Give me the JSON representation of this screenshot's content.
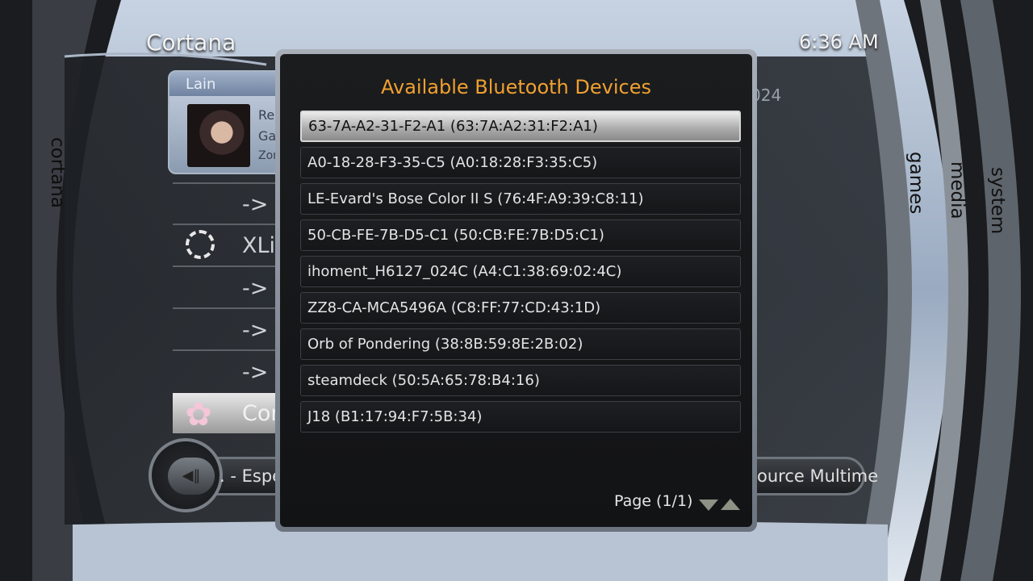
{
  "header": {
    "title": "Cortana",
    "clock": "6:36 AM"
  },
  "tabs": {
    "left": "cortana",
    "right": [
      "games",
      "media",
      "system"
    ]
  },
  "profile": {
    "name": "Lain",
    "line1": "Rep",
    "line2": "Gar",
    "line3": "Zon"
  },
  "background_list": {
    "rows": [
      "-> Ex",
      "XLin",
      "-> S",
      "-> S",
      "-> Ex",
      "Cort"
    ],
    "partial_right_1": "024"
  },
  "music": {
    "ticker": ". - Esperanto: The Language That Wanted to Unite the World – Free Source Multime",
    "ticker_visible": ". - Espe",
    "ticker_tail": "ource Multime"
  },
  "dialog": {
    "title": "Available Bluetooth Devices",
    "devices": [
      "63-7A-A2-31-F2-A1 (63:7A:A2:31:F2:A1)",
      "A0-18-28-F3-35-C5 (A0:18:28:F3:35:C5)",
      "LE-Evard's Bose Color II S (76:4F:A9:39:C8:11)",
      "50-CB-FE-7B-D5-C1 (50:CB:FE:7B:D5:C1)",
      "ihoment_H6127_024C (A4:C1:38:69:02:4C)",
      "ZZ8-CA-MCA5496A (C8:FF:77:CD:43:1D)",
      "Orb of Pondering (38:8B:59:8E:2B:02)",
      "steamdeck (50:5A:65:78:B4:16)",
      "J18 (B1:17:94:F7:5B:34)"
    ],
    "pager": "Page (1/1)"
  },
  "colors": {
    "accent": "#f0a030",
    "selected_bg": "#d8d8d8"
  }
}
